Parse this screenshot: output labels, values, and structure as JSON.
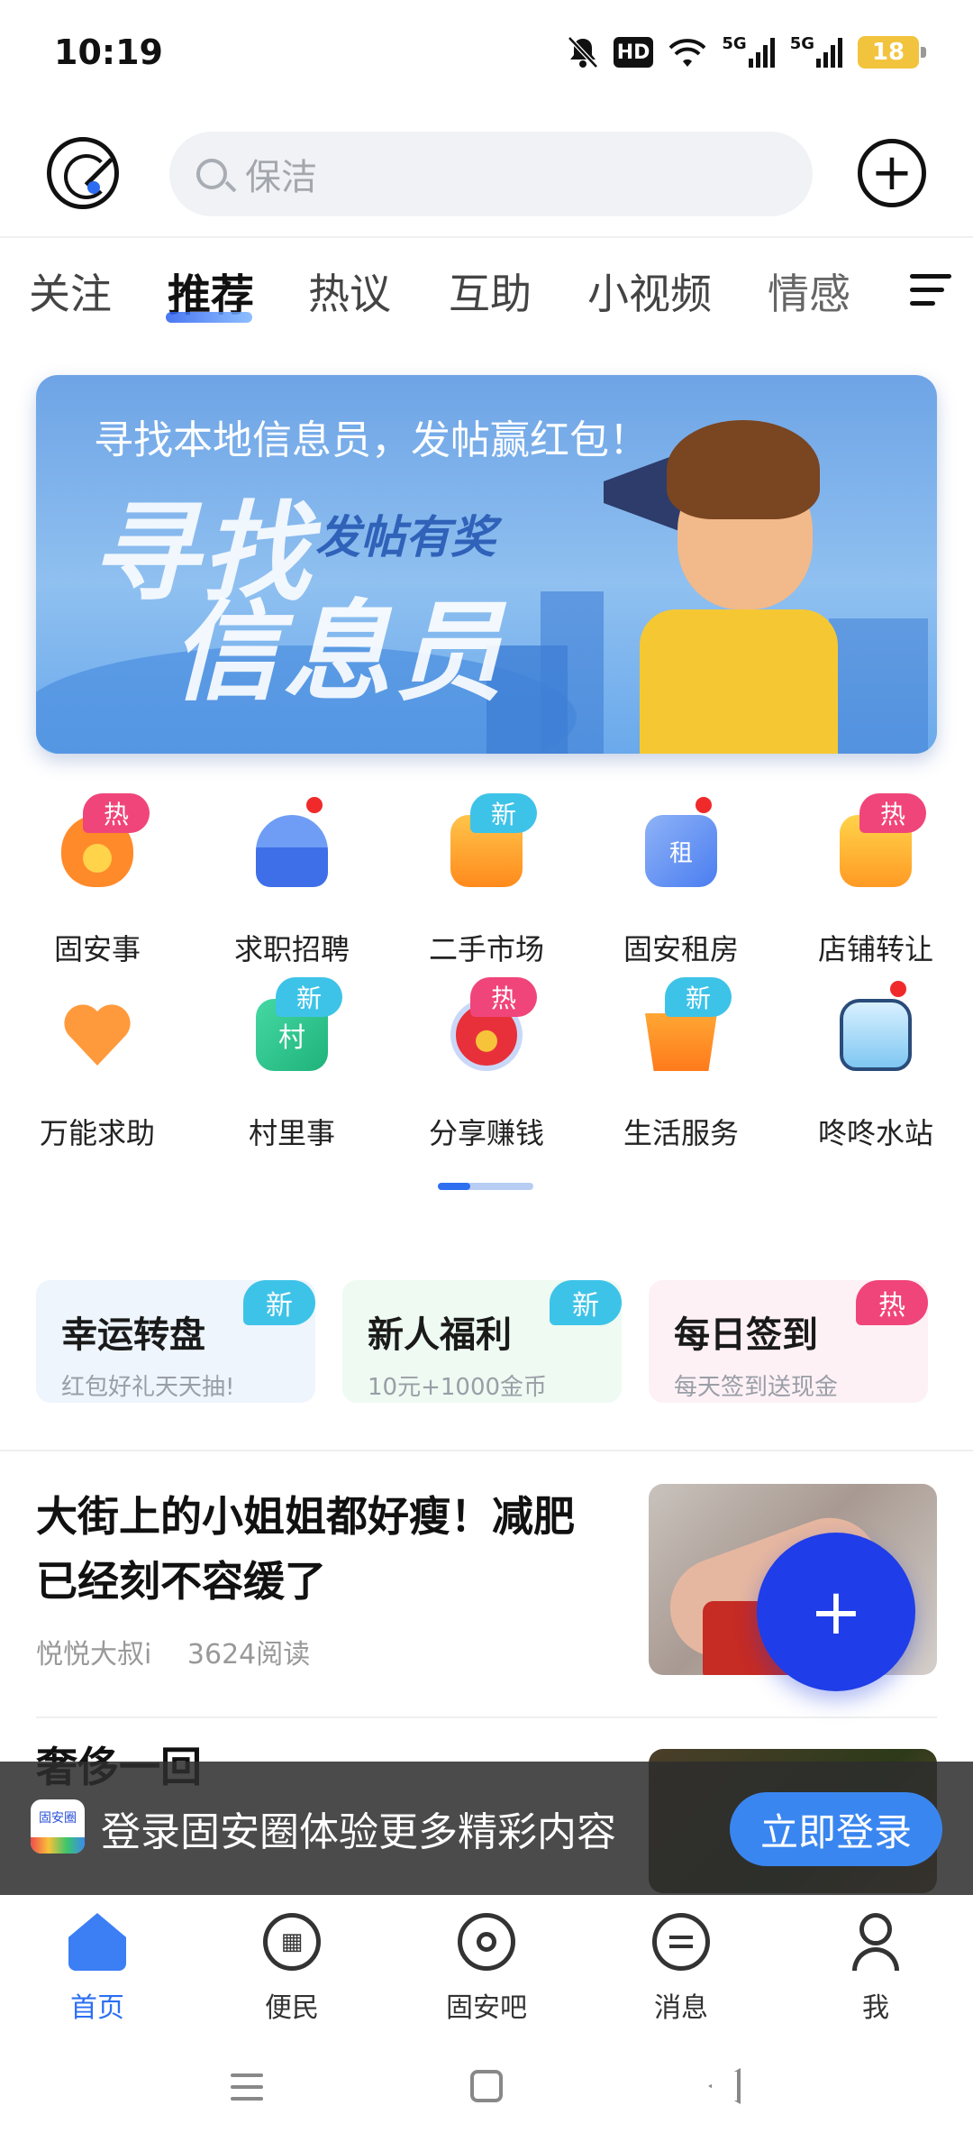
{
  "status_bar": {
    "time": "10:19",
    "icons": [
      "bell-off-icon",
      "hd-icon",
      "wifi-icon",
      "signal-5g-icon",
      "signal-5g-icon"
    ],
    "hd_label": "HD",
    "net1": "5G",
    "net2": "5G",
    "battery": "18"
  },
  "search": {
    "placeholder": "保洁"
  },
  "tabs": [
    "关注",
    "推荐",
    "热议",
    "互助",
    "小视频",
    "情感"
  ],
  "active_tab": "推荐",
  "banner": {
    "caption": "寻找本地信息员，发帖赢红包！",
    "art_line1": "寻找",
    "art_line2": "信息员",
    "art_sub": "发帖有奖"
  },
  "grid": [
    {
      "label": "固安事",
      "badge": "热",
      "badge_color": "#f0457a",
      "icon_color": "#ff8a2a",
      "dot": false
    },
    {
      "label": "求职招聘",
      "badge": "",
      "badge_color": "",
      "icon_color": "#4a7df0",
      "dot": true
    },
    {
      "label": "二手市场",
      "badge": "新",
      "badge_color": "#3ec3e8",
      "icon_color": "#ff9a24",
      "dot": false
    },
    {
      "label": "固安租房",
      "badge": "",
      "badge_color": "",
      "icon_color": "#5a8cf2",
      "dot": true
    },
    {
      "label": "店铺转让",
      "badge": "热",
      "badge_color": "#f0457a",
      "icon_color": "#ffa82a",
      "dot": false
    },
    {
      "label": "万能求助",
      "badge": "",
      "badge_color": "",
      "icon_color": "#ff9a3c",
      "dot": false
    },
    {
      "label": "村里事",
      "badge": "新",
      "badge_color": "#3ec3e8",
      "icon_color": "#2ec58e",
      "dot": false
    },
    {
      "label": "分享赚钱",
      "badge": "热",
      "badge_color": "#f0457a",
      "icon_color": "#e8303a",
      "dot": false
    },
    {
      "label": "生活服务",
      "badge": "新",
      "badge_color": "#3ec3e8",
      "icon_color": "#ff9a24",
      "dot": false
    },
    {
      "label": "咚咚水站",
      "badge": "",
      "badge_color": "",
      "icon_color": "#8ed0f4",
      "dot": true
    }
  ],
  "grid_badges": {
    "hot": "热",
    "new": "新"
  },
  "promos": [
    {
      "title": "幸运转盘",
      "subtitle": "红包好礼天天抽!",
      "badge": "新",
      "badge_color": "#3ec3e8",
      "bg": "#eef5fd"
    },
    {
      "title": "新人福利",
      "subtitle": "10元+1000金币",
      "badge": "新",
      "badge_color": "#3ec3e8",
      "bg": "#eefaf2"
    },
    {
      "title": "每日签到",
      "subtitle": "每天签到送现金",
      "badge": "热",
      "badge_color": "#f0457a",
      "bg": "#fdf1f6"
    }
  ],
  "articles": [
    {
      "title": "大街上的小姐姐都好瘦！减肥已经刻不容缓了",
      "author": "悦悦大叔i",
      "reads": "3624阅读"
    },
    {
      "title": "奢侈一回",
      "author": "",
      "reads": ""
    }
  ],
  "fab_label": "+",
  "login_bar": {
    "logo_text": "固安圈",
    "text": "登录固安圈体验更多精彩内容",
    "button": "立即登录"
  },
  "bottom_nav": [
    {
      "label": "首页",
      "icon": "home-icon",
      "active": true
    },
    {
      "label": "便民",
      "icon": "grid-icon",
      "active": false
    },
    {
      "label": "固安吧",
      "icon": "chat-circle-icon",
      "active": false
    },
    {
      "label": "消息",
      "icon": "message-icon",
      "active": false
    },
    {
      "label": "我",
      "icon": "person-icon",
      "active": false
    }
  ],
  "colors": {
    "accent": "#2c6ff2",
    "fab": "#1f3de8",
    "login_button": "#3a86f0"
  }
}
